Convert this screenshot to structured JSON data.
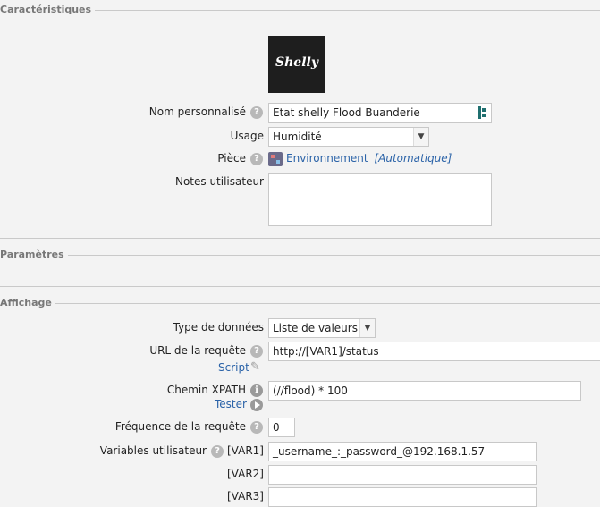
{
  "sections": {
    "characteristics": "Caractéristiques",
    "parameters": "Paramètres",
    "display": "Affichage"
  },
  "device": {
    "logo_text": "Shelly",
    "custom_name_label": "Nom personnalisé",
    "custom_name_value": "Etat shelly Flood Buanderie",
    "usage_label": "Usage",
    "usage_value": "Humidité",
    "room_label": "Pièce",
    "room_value": "Environnement",
    "room_auto": "[Automatique]",
    "notes_label": "Notes utilisateur",
    "notes_value": ""
  },
  "display": {
    "data_type_label": "Type de données",
    "data_type_value": "Liste de valeurs",
    "url_label": "URL de la requête",
    "url_value": "http://[VAR1]/status",
    "script_link": "Script",
    "xpath_label": "Chemin XPATH",
    "xpath_value": "(//flood) * 100",
    "test_link": "Tester",
    "frequency_label": "Fréquence de la requête",
    "frequency_value": "0",
    "user_vars_label": "Variables utilisateur",
    "var1_label": "[VAR1]",
    "var1_value": "_username_:_password_@192.168.1.57",
    "var2_label": "[VAR2]",
    "var2_value": "",
    "var3_label": "[VAR3]",
    "var3_value": ""
  },
  "colors": {
    "link": "#2b63a8",
    "background": "#f3f3f3",
    "logo_bg": "#1e1e1e"
  }
}
